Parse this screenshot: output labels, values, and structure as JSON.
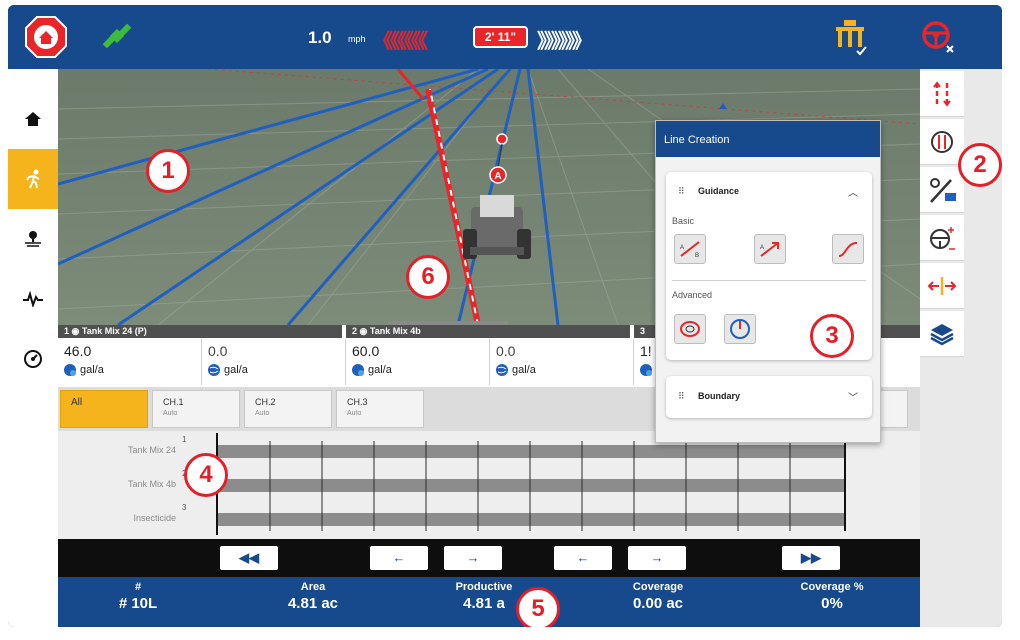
{
  "top_bar": {
    "speed_value": "1.0",
    "speed_unit": "mph",
    "chevrons_left": "《《《《《《",
    "offset_badge": "2' 11\"",
    "chevrons_right": "》》》》》》",
    "colors": {
      "bar": "#174a8c",
      "accent_red": "#e8262a",
      "gps_green": "#3dbb3d",
      "implement_yellow": "#f6b41c"
    }
  },
  "left_sidebar": {
    "items": [
      {
        "icon": "home-icon",
        "active": false
      },
      {
        "icon": "runner-icon",
        "active": true
      },
      {
        "icon": "field-pin-icon",
        "active": false
      },
      {
        "icon": "diagnostics-pulse-icon",
        "active": false
      },
      {
        "icon": "settings-gauge-icon",
        "active": false
      }
    ]
  },
  "right_sidebar": {
    "items": [
      "guidance-lines-icon",
      "line-cycle-icon",
      "line-creation-icon",
      "steering-sensitivity-icon",
      "nudge-icon",
      "layers-icon"
    ]
  },
  "map_view": {
    "point_a_marker": "A"
  },
  "products": [
    {
      "header": "1 ◉ Tank Mix 24 (P)",
      "target": "46.0",
      "target_unit": "gal/a",
      "actual": "0.0",
      "actual_unit": "gal/a"
    },
    {
      "header": "2 ◉ Tank Mix 4b",
      "target": "60.0",
      "target_unit": "gal/a",
      "actual": "0.0",
      "actual_unit": "gal/a"
    },
    {
      "header": "3",
      "target": "1!",
      "target_unit": "g",
      "actual": "",
      "actual_unit": ""
    }
  ],
  "channels": {
    "tabs": [
      {
        "label": "All",
        "sub": ""
      },
      {
        "label": "CH.1",
        "sub": "Auto"
      },
      {
        "label": "CH.2",
        "sub": "Auto"
      },
      {
        "label": "CH.3",
        "sub": "Auto"
      }
    ]
  },
  "sections": {
    "rows": [
      {
        "label": "Tank Mix 24",
        "number": "1"
      },
      {
        "label": "Tank Mix 4b",
        "number": "2"
      },
      {
        "label": "Insecticide",
        "number": "3"
      }
    ]
  },
  "playback": {
    "buttons": [
      "◀◀",
      "←",
      "→",
      "←",
      "→",
      "▶▶"
    ]
  },
  "stats": [
    {
      "label": "#",
      "value": "# 10L"
    },
    {
      "label": "Area",
      "value": "4.81 ac"
    },
    {
      "label": "Productive",
      "value": "4.81 a"
    },
    {
      "label": "Coverage",
      "value": "0.00 ac"
    },
    {
      "label": "Coverage %",
      "value": "0%"
    }
  ],
  "line_creation": {
    "title": "Line Creation",
    "guidance_section": "Guidance",
    "basic_label": "Basic",
    "advanced_label": "Advanced",
    "boundary_section": "Boundary",
    "basic_buttons": [
      "ab-straight-line-icon",
      "a-plus-heading-icon",
      "curve-line-icon"
    ],
    "advanced_buttons": [
      "pivot-line-icon",
      "circle-line-icon"
    ]
  },
  "callouts": [
    "1",
    "2",
    "3",
    "4",
    "5",
    "6"
  ]
}
